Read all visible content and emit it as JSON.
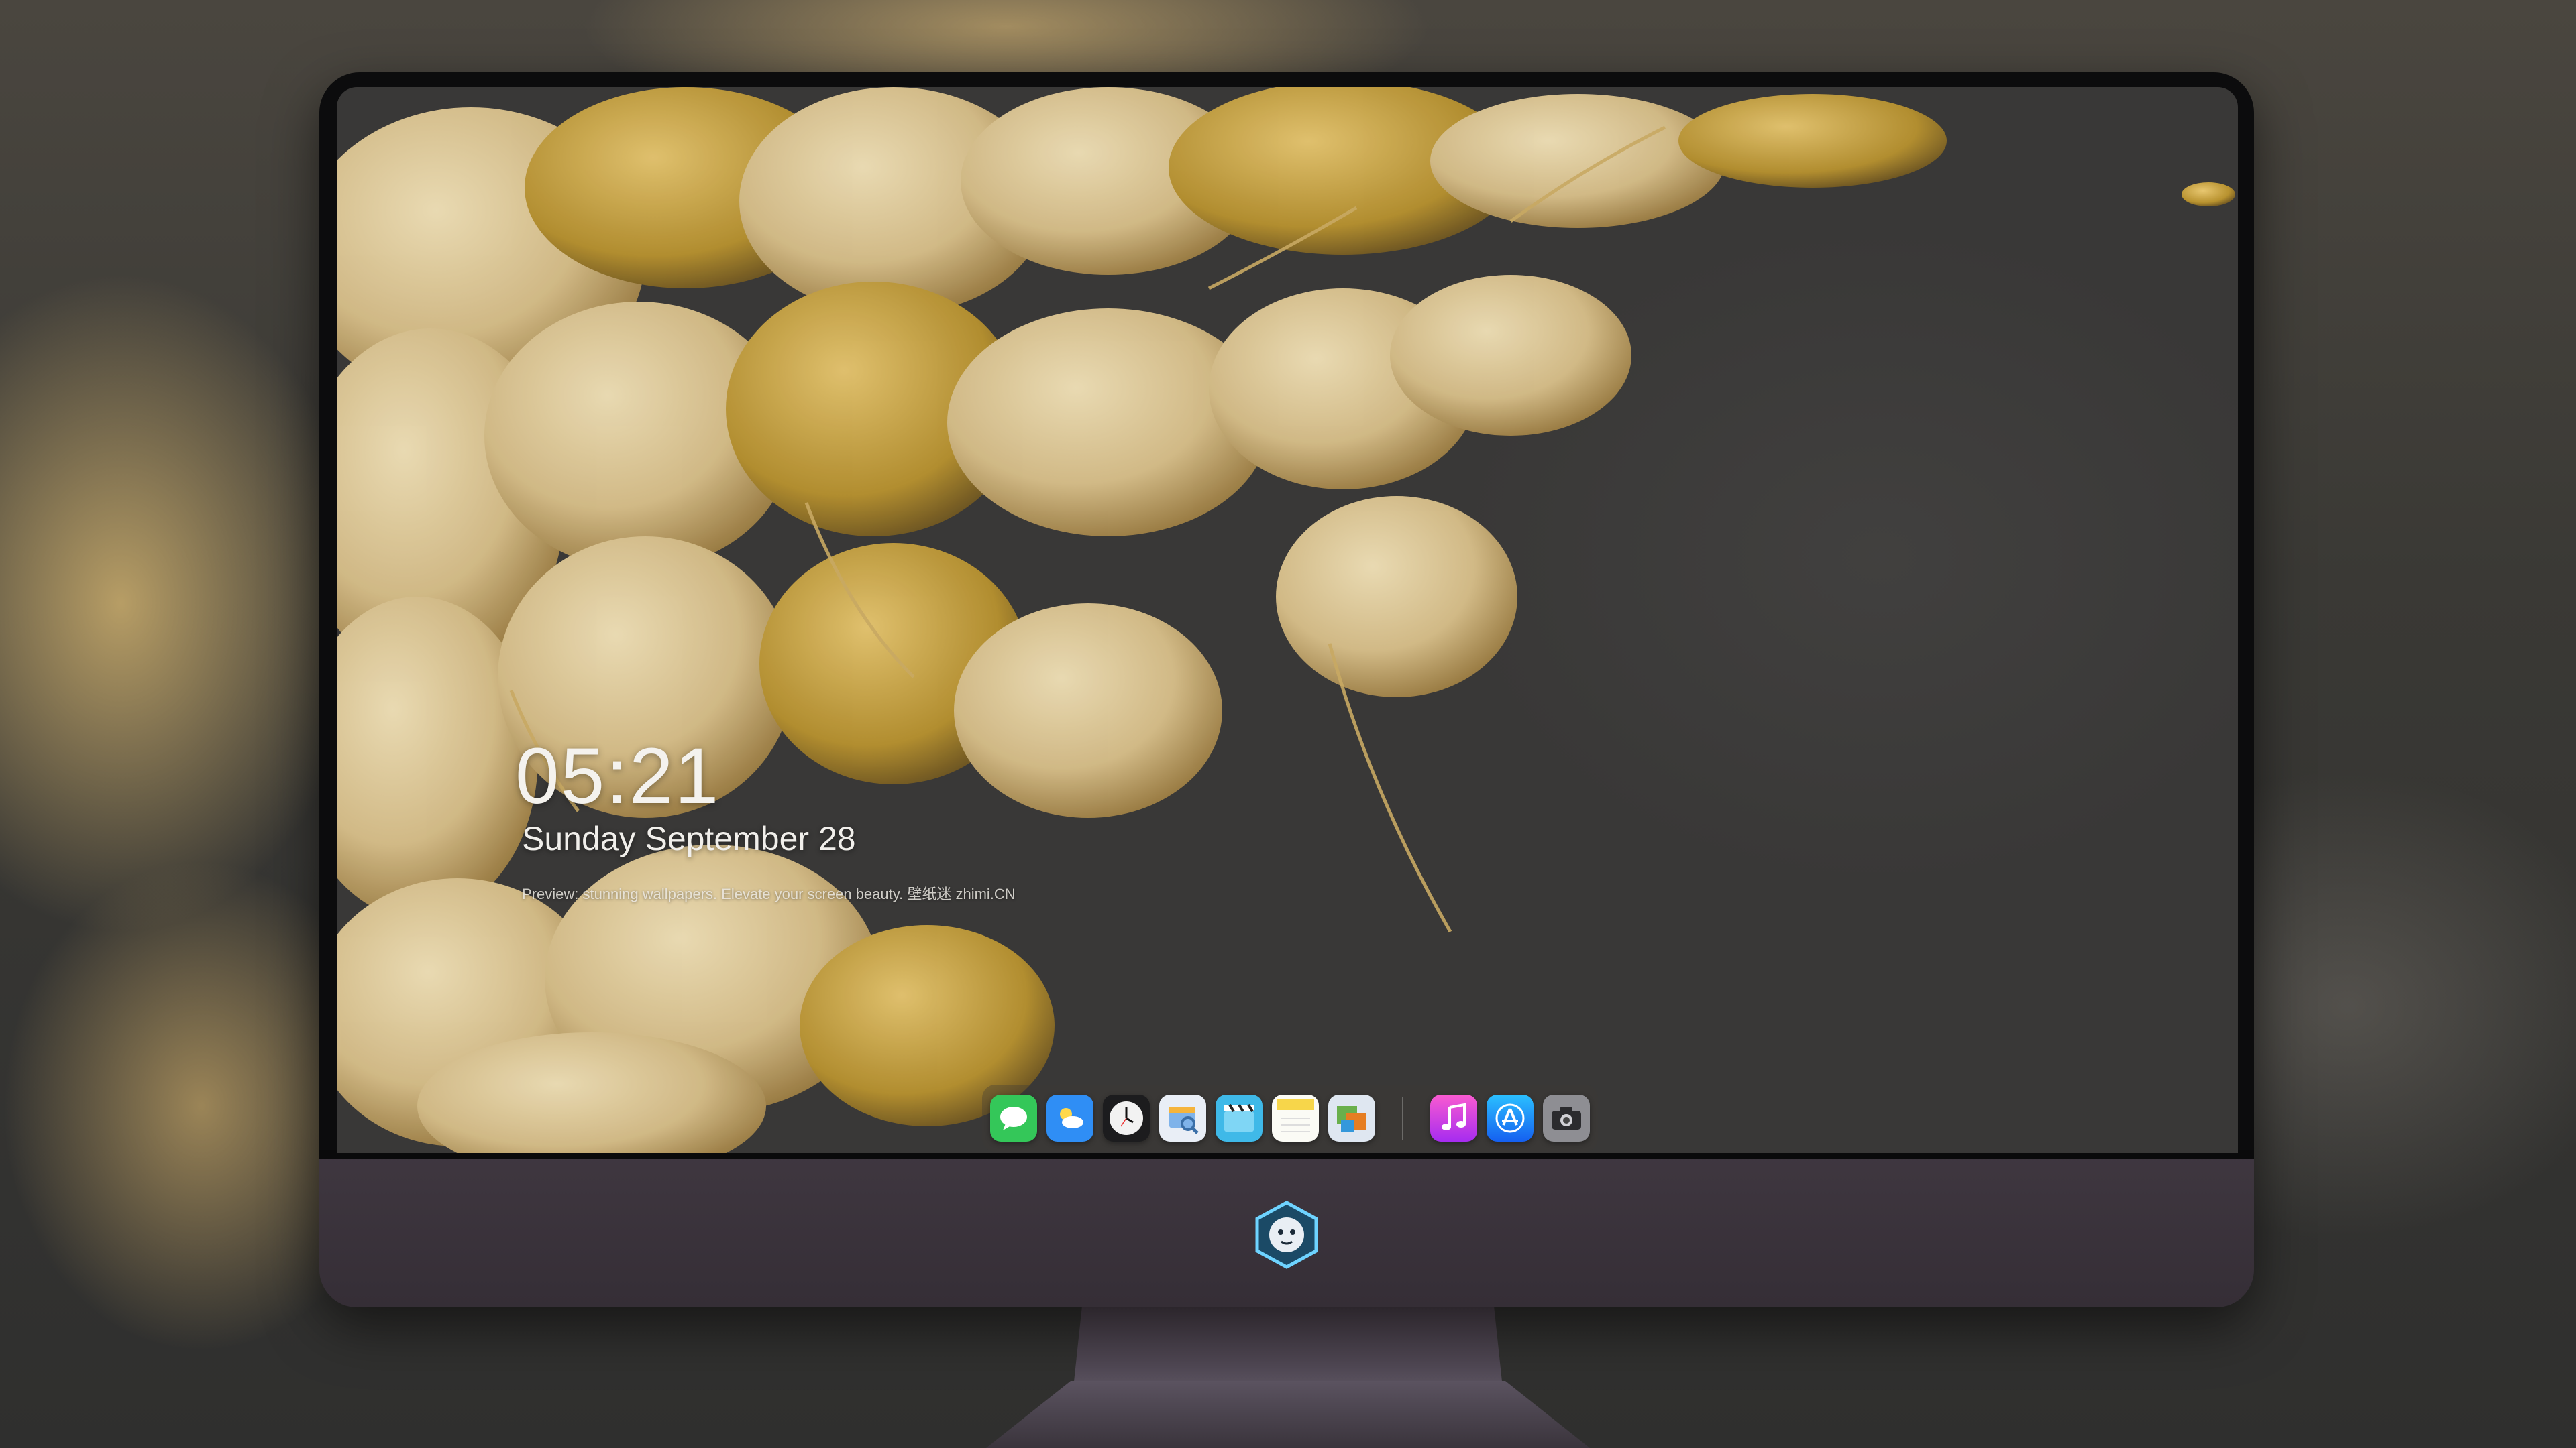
{
  "lockscreen": {
    "time": "05:21",
    "date": "Sunday September  28",
    "preview_text": "Preview: stunning wallpapers. Elevate your screen beauty. 壁纸迷 zhimi.CN"
  },
  "dock": {
    "apps": [
      {
        "name": "Messages",
        "icon": "messages-icon",
        "color": "#34c759",
        "glyph": "💬"
      },
      {
        "name": "Weather",
        "icon": "weather-icon",
        "color": "#2f8ef5",
        "glyph": "⛅"
      },
      {
        "name": "Clock",
        "icon": "clock-icon",
        "color": "#f2f2f2",
        "glyph": "🕐"
      },
      {
        "name": "Preview",
        "icon": "preview-icon",
        "color": "#e9eef6",
        "glyph": "🔍"
      },
      {
        "name": "Clips",
        "icon": "clips-icon",
        "color": "#3fb9e8",
        "glyph": "🎬"
      },
      {
        "name": "Notes",
        "icon": "notes-icon",
        "color": "#f7d64a",
        "glyph": "📝"
      },
      {
        "name": "Photo Browser",
        "icon": "photos-icon",
        "color": "#dfe7f1",
        "glyph": "🖼"
      },
      {
        "name": "Music",
        "icon": "music-icon",
        "color": "#e9308a",
        "glyph": "♫"
      },
      {
        "name": "App Store",
        "icon": "app-store-icon",
        "color": "#1e8df5",
        "glyph": "A"
      },
      {
        "name": "Camera",
        "icon": "camera-icon",
        "color": "#8e8e93",
        "glyph": "📷"
      }
    ]
  },
  "colors": {
    "screen_bg": "#393837",
    "leaf": "#d9c08a",
    "bezel": "#0c0c0d",
    "chin": "#3f3740"
  }
}
